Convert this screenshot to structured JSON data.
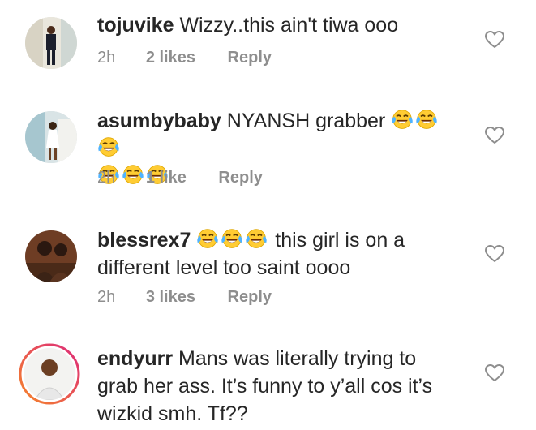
{
  "comments": [
    {
      "username": "tojuvike",
      "text": "Wizzy..this ain't tiwa ooo",
      "time": "2h",
      "likes": "2 likes",
      "reply": "Reply"
    },
    {
      "username": "asumbybaby",
      "text": "NYANSH grabber",
      "emoji_icon": "tears-of-joy-emoji",
      "time": "2h",
      "likes": "1 like",
      "reply": "Reply"
    },
    {
      "username": "blessrex7",
      "text": "this girl is on a different level too saint oooo",
      "emoji_icon": "tears-of-joy-emoji",
      "time": "2h",
      "likes": "3 likes",
      "reply": "Reply"
    },
    {
      "username": "endyurr",
      "text": "Mans was literally trying to grab her ass. It’s funny to y’all cos it’s wizkid smh. Tf??"
    }
  ],
  "colors": {
    "text": "#262626",
    "meta": "#8e8e8e",
    "story_ring_start": "#f58529",
    "story_ring_end": "#dd2a7b"
  },
  "icons": {
    "like": "heart-outline-icon"
  }
}
